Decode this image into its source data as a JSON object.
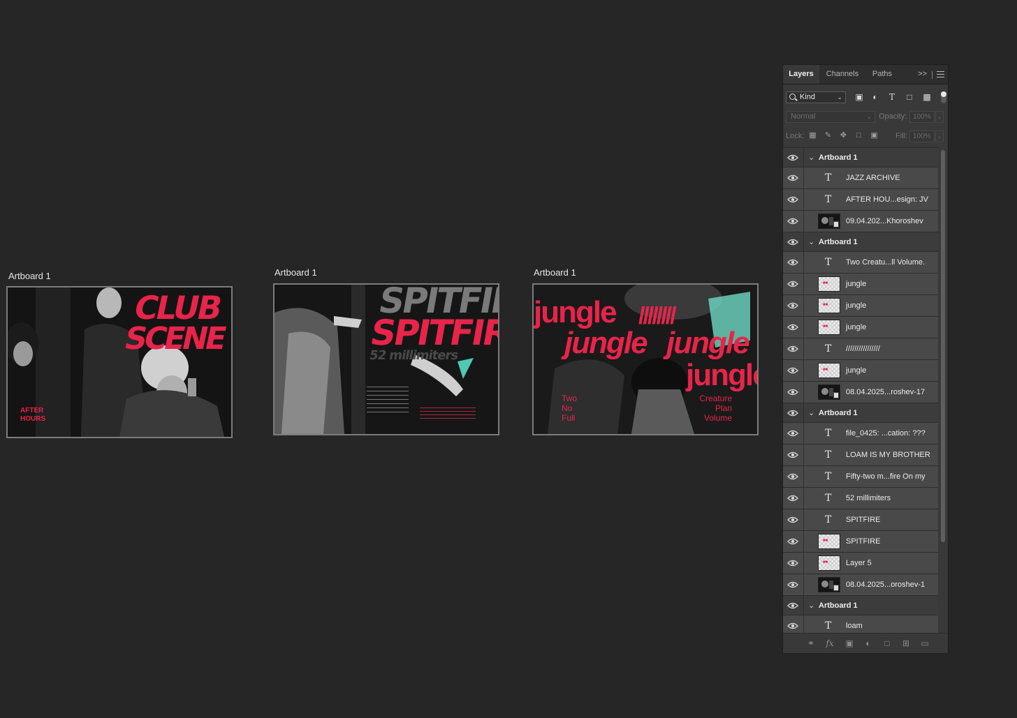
{
  "artboards": [
    {
      "title": "Artboard 1",
      "headline_top": "CLUB",
      "headline_bottom": "SCENE",
      "badge_top": "AFTER",
      "badge_bottom": "HOURS"
    },
    {
      "title": "Artboard 1",
      "headline": "SPITFIRE",
      "subline": "52 millimiters"
    },
    {
      "title": "Artboard 1",
      "word": "jungle",
      "slashes": "////////",
      "left_words": [
        "Two",
        "No",
        "Full"
      ],
      "right_words": [
        "Creature",
        "Plan",
        "Volume"
      ]
    }
  ],
  "panel": {
    "tabs": [
      "Layers",
      "Channels",
      "Paths"
    ],
    "active_tab": "Layers",
    "more_glyph": ">>",
    "filter": {
      "kind_label": "Kind"
    },
    "blend_mode": "Normal",
    "opacity_label": "Opacity:",
    "opacity_value": "100%",
    "lock_label": "Lock:",
    "fill_label": "Fill:",
    "fill_value": "100%",
    "layers": [
      {
        "type": "group",
        "name": "Artboard 1"
      },
      {
        "type": "text",
        "name": "JAZZ ARCHIVE"
      },
      {
        "type": "text",
        "name": "AFTER HOU...esign: JV"
      },
      {
        "type": "photo",
        "name": "09.04.202...Khoroshev"
      },
      {
        "type": "group",
        "name": "Artboard 1"
      },
      {
        "type": "text",
        "name": "Two Creatu...ll Volume."
      },
      {
        "type": "smart",
        "name": "jungle"
      },
      {
        "type": "smart",
        "name": "jungle"
      },
      {
        "type": "smart",
        "name": "jungle"
      },
      {
        "type": "text",
        "name": "////////////////"
      },
      {
        "type": "smart",
        "name": "jungle"
      },
      {
        "type": "photo",
        "name": "08.04.2025...roshev-17"
      },
      {
        "type": "group",
        "name": "Artboard 1"
      },
      {
        "type": "text",
        "name": "file_0425: ...cation: ???"
      },
      {
        "type": "text",
        "name": "LOAM IS MY BROTHER"
      },
      {
        "type": "text",
        "name": "Fifty-two m...fire On my"
      },
      {
        "type": "text",
        "name": "52 millimiters"
      },
      {
        "type": "text",
        "name": "SPITFIRE"
      },
      {
        "type": "smart",
        "name": "SPITFIRE"
      },
      {
        "type": "smart",
        "name": "Layer 5"
      },
      {
        "type": "photo",
        "name": "08.04.2025...oroshev-1"
      },
      {
        "type": "group",
        "name": "Artboard 1"
      },
      {
        "type": "text",
        "name": "loam"
      }
    ]
  },
  "colors": {
    "accent": "#e8244a",
    "canvas": "#262626",
    "panel": "#393939"
  }
}
